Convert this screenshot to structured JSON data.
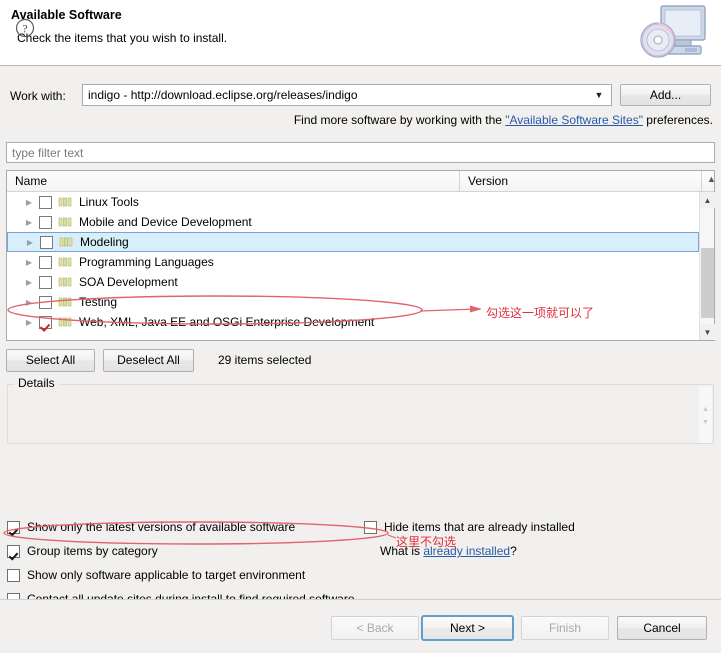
{
  "header": {
    "title": "Available Software",
    "subtitle": "Check the items that you wish to install.",
    "icon": "install-monitor-disc-icon"
  },
  "work_with": {
    "label": "Work with:",
    "value": "indigo - http://download.eclipse.org/releases/indigo",
    "dropdown_icon": "chevron-down-icon",
    "add_button": "Add..."
  },
  "find_more": {
    "prefix": "Find more software by working with the ",
    "link": "\"Available Software Sites\"",
    "suffix": " preferences."
  },
  "filter": {
    "placeholder": "type filter text",
    "value": ""
  },
  "tree": {
    "columns": {
      "name": "Name",
      "version": "Version"
    },
    "sort_icon": "chevron-up-icon",
    "rows": [
      {
        "label": "Linux Tools",
        "checked": false,
        "selected": false
      },
      {
        "label": "Mobile and Device Development",
        "checked": false,
        "selected": false
      },
      {
        "label": "Modeling",
        "checked": false,
        "selected": true
      },
      {
        "label": "Programming Languages",
        "checked": false,
        "selected": false
      },
      {
        "label": "SOA Development",
        "checked": false,
        "selected": false
      },
      {
        "label": "Testing",
        "checked": false,
        "selected": false
      },
      {
        "label": "Web, XML, Java EE and OSGi Enterprise Development",
        "checked": true,
        "selected": false
      }
    ],
    "expand_icon": "triangle-right-icon",
    "category_icon": "category-bars-icon",
    "scrollbar": {
      "up_icon": "scroll-up-icon",
      "down_icon": "scroll-down-icon"
    }
  },
  "selection_bar": {
    "select_all": "Select All",
    "deselect_all": "Deselect All",
    "status": "29 items selected"
  },
  "details": {
    "legend": "Details",
    "content": "",
    "scroll_up_icon": "scroll-up-icon",
    "scroll_down_icon": "scroll-down-icon"
  },
  "options": [
    {
      "label": "Show only the latest versions of available software",
      "checked": true
    },
    {
      "label": "Group items by category",
      "checked": true
    },
    {
      "label": "Show only software applicable to target environment",
      "checked": false
    },
    {
      "label": "Contact all update sites during install to find required software",
      "checked": false
    }
  ],
  "options_right": [
    {
      "label": "Hide items that are already installed",
      "checked": false
    }
  ],
  "what_is": {
    "prefix": "What is ",
    "link": "already installed",
    "suffix": "?"
  },
  "footer": {
    "help_icon": "help-question-icon",
    "back": "< Back",
    "next": "Next >",
    "finish": "Finish",
    "cancel": "Cancel"
  },
  "annotations": [
    {
      "text": "勾选这一项就可以了",
      "target": "web-xml-javaee-row"
    },
    {
      "text": "这里不勾选",
      "target": "contact-all-update-sites-option"
    }
  ],
  "colors": {
    "annotation_red": "#e0303c",
    "selection_blue": "#d7eefb",
    "link_blue": "#2a59a8",
    "focus_blue": "#5f9ecb",
    "window_bg": "#f1f0ee"
  }
}
